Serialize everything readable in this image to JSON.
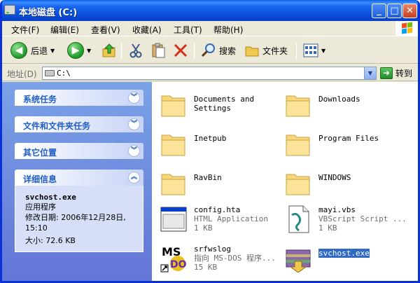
{
  "window": {
    "title": "本地磁盘 (C:)"
  },
  "titlebar_buttons": {
    "minimize": "_",
    "maximize": "□",
    "close": "✕"
  },
  "menubar": {
    "items": [
      {
        "label": "文件(F)"
      },
      {
        "label": "编辑(E)"
      },
      {
        "label": "查看(V)"
      },
      {
        "label": "收藏(A)"
      },
      {
        "label": "工具(T)"
      },
      {
        "label": "帮助(H)"
      }
    ]
  },
  "toolbar": {
    "back_label": "后退",
    "search_label": "搜索",
    "folders_label": "文件夹"
  },
  "addressbar": {
    "label": "地址(D)",
    "value": "C:\\",
    "go_label": "转到"
  },
  "leftpane": {
    "panels": [
      {
        "title": "系统任务"
      },
      {
        "title": "文件和文件夹任务"
      },
      {
        "title": "其它位置"
      },
      {
        "title": "详细信息"
      }
    ],
    "details": {
      "name": "svchost.exe",
      "type": "应用程序",
      "modified_label": "修改日期: 2006年12月28日,",
      "modified_time": "15:10",
      "size": "大小: 72.6 KB"
    }
  },
  "files": [
    {
      "name": "Documents and\nSettings",
      "kind": "folder"
    },
    {
      "name": "Downloads",
      "kind": "folder"
    },
    {
      "name": "Inetpub",
      "kind": "folder"
    },
    {
      "name": "Program Files",
      "kind": "folder"
    },
    {
      "name": "RavBin",
      "kind": "folder"
    },
    {
      "name": "WINDOWS",
      "kind": "folder"
    },
    {
      "name": "config.hta",
      "type": "HTML Application",
      "size": "1 KB",
      "kind": "hta"
    },
    {
      "name": "mayi.vbs",
      "type": "VBScript Script ...",
      "size": "1 KB",
      "kind": "vbs"
    },
    {
      "name": "srfwslog",
      "type": "指向 MS-DOS 程序...",
      "size": "15 KB",
      "kind": "msdos"
    },
    {
      "name": "svchost.exe",
      "kind": "exe",
      "selected": true
    }
  ]
}
